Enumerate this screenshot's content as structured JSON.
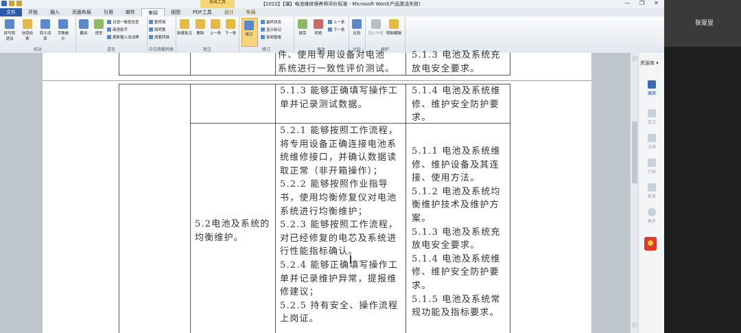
{
  "titlebar": {
    "title": "【2022】【课】电池维修保养师评价标准 - Microsoft Word(产品激活失败)",
    "context_group": "表格工具",
    "controls": [
      "—",
      "❐",
      "✕"
    ]
  },
  "tabs": [
    "文件",
    "开始",
    "插入",
    "页面布局",
    "引用",
    "邮件",
    "审阅",
    "视图",
    "PDF工具",
    "设计",
    "布局"
  ],
  "ribbon": {
    "groups": [
      {
        "label": "校对",
        "buttons": [
          "拼写和语法",
          "信息检索",
          "同义词库",
          "字数统计"
        ]
      },
      {
        "label": "语言",
        "buttons": [
          "翻译",
          "语言"
        ],
        "small": [
          "日语一致性检查",
          "简语助手",
          "更新输入法词典"
        ]
      },
      {
        "label": "中文简繁转换",
        "small": [
          "繁转简",
          "简转繁",
          "简繁转换"
        ]
      },
      {
        "label": "批注",
        "buttons": [
          "新建批注",
          "删除",
          "上一条",
          "下一条"
        ]
      },
      {
        "label": "修订",
        "buttons": [
          "修订"
        ],
        "small": [
          "最终状态",
          "显示标记",
          "审阅窗格"
        ]
      },
      {
        "label": "更改",
        "buttons": [
          "接受",
          "拒绝"
        ],
        "small": [
          "上一条",
          "下一条"
        ]
      },
      {
        "label": "比较",
        "buttons": [
          "比较"
        ]
      },
      {
        "label": "保护",
        "buttons": [
          "阻止作者",
          "限制编辑"
        ]
      }
    ]
  },
  "document": {
    "rows": [
      {
        "col2": "",
        "col3": "件、使用专用设备对电池系统进行一致性评价测试。",
        "col4": "5.1.3 电池及系统充放电安全要求。"
      },
      {
        "col2": "",
        "col3": "5.1.3 能够正确填写操作工单并记录测试数据。",
        "col4": "5.1.4 电池及系统维修、维护安全防护要求。"
      },
      {
        "col2": "5.2电池及系统的均衡维护。",
        "col3_lines": [
          "5.2.1 能够按照工作流程，",
          "将专用设备正确连接电池系",
          "统维修接口，并确认数据读",
          "取正常（非开箱操作）；",
          "5.2.2 能够按照作业指导",
          "书，使用均衡修复仪对电池",
          "系统进行均衡维护；",
          "5.2.3  能够按照工作流程，",
          "对已经修复的电芯及系统进",
          "行性能指标确认。",
          "5.2.4 能够正确填写操作工",
          "单并记录维护异常，提报维",
          "修建议；",
          "5.2.5 持有安全、操作流程",
          "上岗证。"
        ],
        "col4_lines": [
          "5.1.1 电池及系统维",
          "修、维护设备及其连",
          "接、使用方法。",
          "5.1.2 电池及系统均",
          "衡维护技术及维护方",
          "案。",
          "5.1.3 电池及系统充",
          "放电安全要求。",
          "5.1.4 电池及系统维",
          "修、维护安全防护要求。",
          "5.1.5 电池及系统常",
          "规功能及指标要求。"
        ]
      }
    ],
    "row1_col3_lines": [
      "件、使用专用设备对电池",
      "系统进行一致性评价测试。"
    ],
    "row1_col4_lines": [
      "5.1.3 电池及系统充",
      "放电安全要求。"
    ],
    "row2_col3_lines": [
      "5.1.3 能够正确填写操作工",
      "单并记录测试数据。"
    ],
    "row2_col4_lines": [
      "5.1.4 电池及系统维",
      "修、维护安全防护要求。"
    ],
    "row3_col2_lines": [
      "5.2电池及系统的",
      "均衡维护。"
    ]
  },
  "side_panel": {
    "title": "资源库 ▾",
    "items": [
      "藏面",
      "范文",
      "法律",
      "行政",
      "教育",
      "更多"
    ]
  },
  "participant": {
    "name": "张旻昱"
  }
}
